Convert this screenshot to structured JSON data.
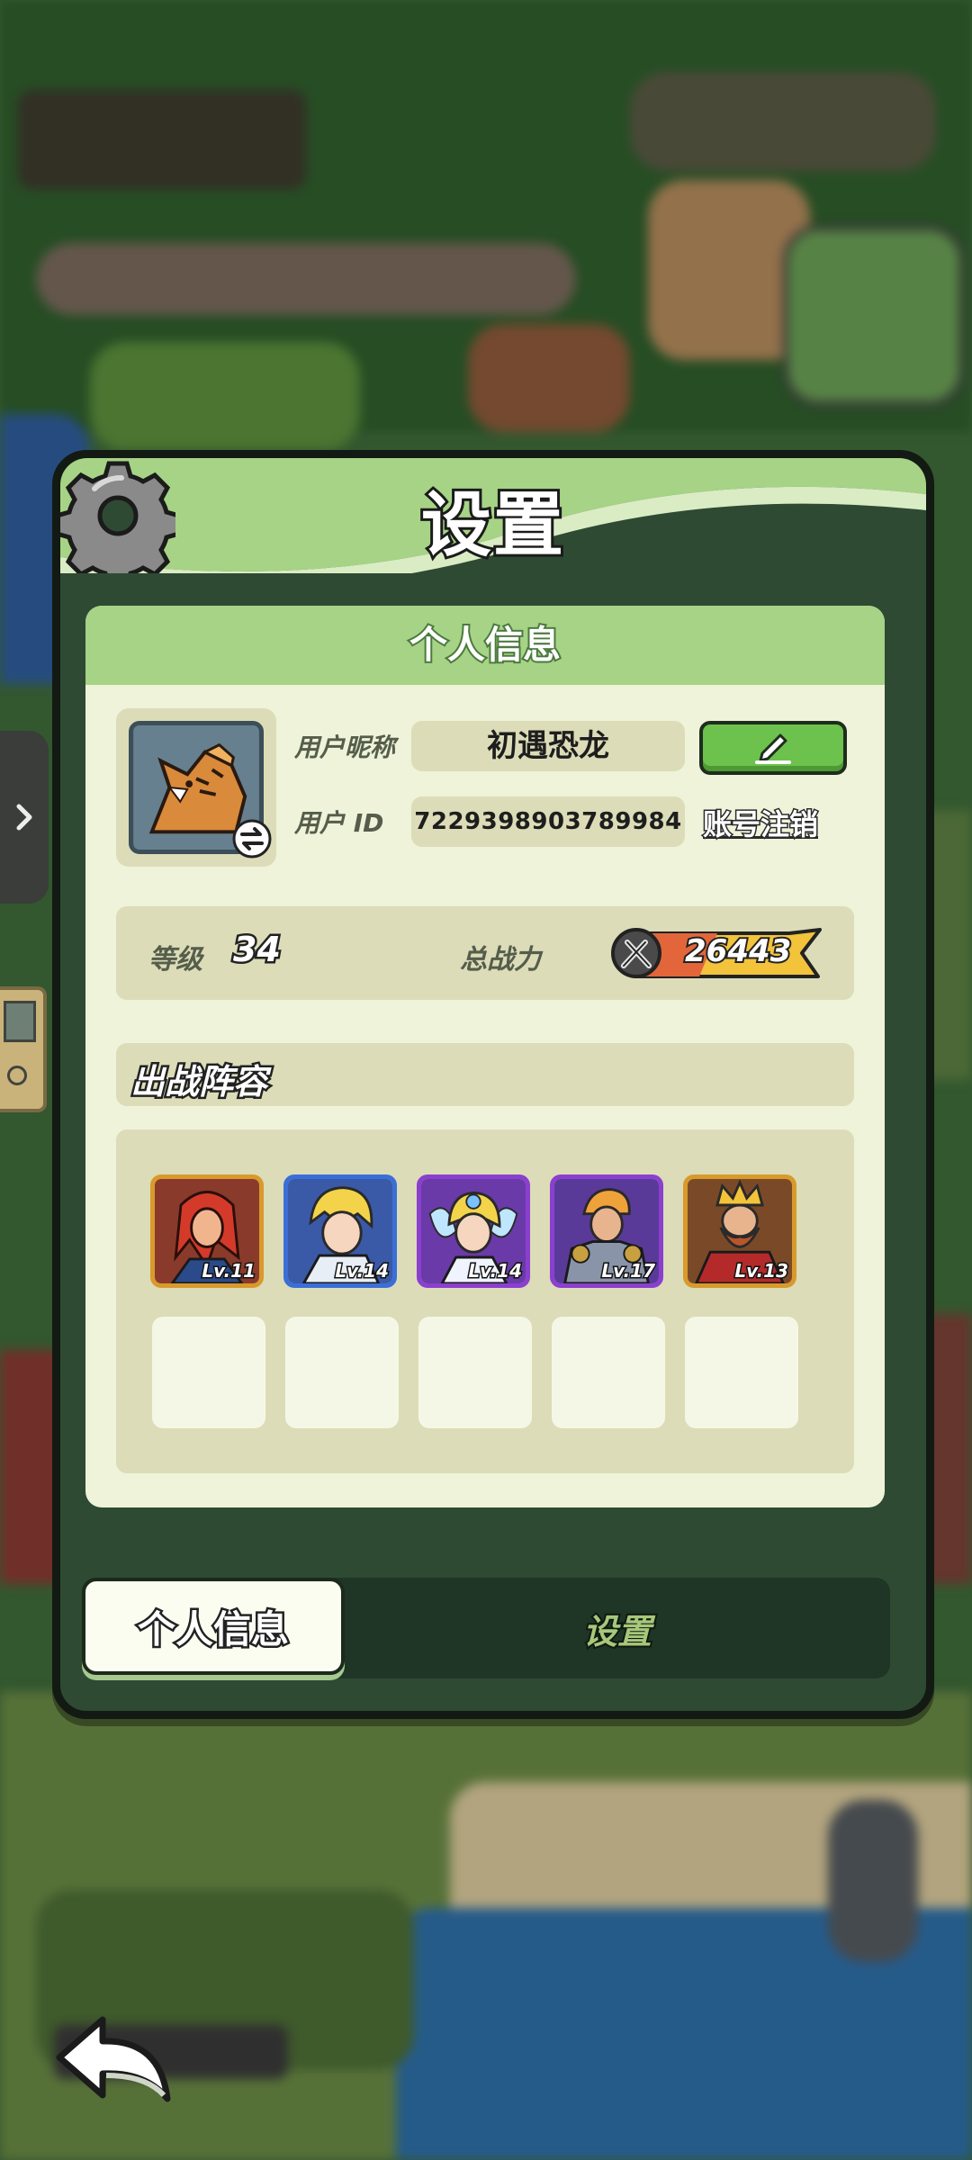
{
  "panel": {
    "title": "设置"
  },
  "profile": {
    "section_title": "个人信息",
    "nickname_label": "用户昵称",
    "nickname": "初遇恐龙",
    "id_label": "用户 ID",
    "user_id": "7229398903789984",
    "cancel_account_label": "账号注销",
    "level_label": "等级",
    "level": "34",
    "power_label": "总战力",
    "power": "26443"
  },
  "lineup": {
    "title": "出战阵容",
    "heroes": [
      {
        "name": "red-hair-hero",
        "level": "Lv.11",
        "frame": "#d89a2b"
      },
      {
        "name": "blonde-knight-hero",
        "level": "Lv.14",
        "frame": "#3b6fd8"
      },
      {
        "name": "fairy-hero",
        "level": "Lv.14",
        "frame": "#8b3fcf"
      },
      {
        "name": "armored-warrior-hero",
        "level": "Lv.17",
        "frame": "#8b3fcf"
      },
      {
        "name": "king-hero",
        "level": "Lv.13",
        "frame": "#d89a2b"
      }
    ],
    "empty_slots": 5
  },
  "tabs": {
    "profile": "个人信息",
    "settings": "设置"
  },
  "colors": {
    "panel_bg": "#2e4a33",
    "header_green": "#a6d385",
    "card_bg": "#eef3d9",
    "edit_button": "#6cc24c",
    "power_bar": "#f2c33b"
  },
  "icons": [
    "gear-icon",
    "swap-icon",
    "pencil-icon",
    "sword-icon",
    "chevron-right-icon",
    "back-arrow-icon"
  ]
}
